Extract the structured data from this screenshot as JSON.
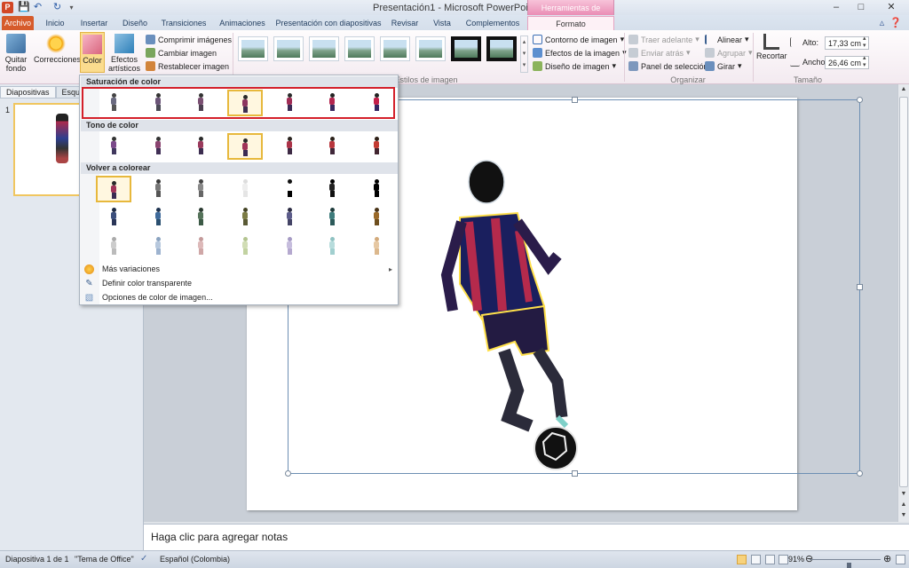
{
  "window": {
    "title": "Presentación1 - Microsoft PowerPoint",
    "context_tools": "Herramientas de imagen"
  },
  "tabs": [
    "Archivo",
    "Inicio",
    "Insertar",
    "Diseño",
    "Transiciones",
    "Animaciones",
    "Presentación con diapositivas",
    "Revisar",
    "Vista",
    "Complementos",
    "Formato"
  ],
  "ribbon": {
    "remove_bg": "Quitar fondo",
    "corrections": "Correcciones",
    "color": "Color",
    "artistic": "Efectos artísticos",
    "compress": "Comprimir imágenes",
    "change": "Cambiar imagen",
    "reset": "Restablecer imagen",
    "styles_label": "Estilos de imagen",
    "border": "Contorno de imagen",
    "effects": "Efectos de la imagen",
    "layout": "Diseño de imagen",
    "bring_forward": "Traer adelante",
    "send_back": "Enviar atrás",
    "selection_pane": "Panel de selección",
    "align": "Alinear",
    "group": "Agrupar",
    "rotate": "Girar",
    "arrange_label": "Organizar",
    "crop": "Recortar",
    "height_label": "Alto:",
    "height_value": "17,33 cm",
    "width_label": "Ancho:",
    "width_value": "26,46 cm",
    "size_label": "Tamaño"
  },
  "left_panel": {
    "tab_slides": "Diapositivas",
    "tab_outline": "Esquema",
    "slide_number": "1"
  },
  "dropdown": {
    "sat_header": "Saturación de color",
    "tone_header": "Tono de color",
    "recolor_header": "Volver a colorear",
    "more_variations": "Más variaciones",
    "set_transparent": "Definir color transparente",
    "picture_color_options": "Opciones de color de imagen..."
  },
  "notes": {
    "placeholder": "Haga clic para agregar notas"
  },
  "status": {
    "slide_info": "Diapositiva 1 de 1",
    "theme": "\"Tema de Office\"",
    "language": "Español (Colombia)",
    "zoom": "91%",
    "zoom_level": 0.55
  },
  "colors": {
    "file_tab": "#d65b2b",
    "context_tab": "#ea8db5",
    "selection_highlight": "#d4202a",
    "selected_swatch": "#e7b83c"
  }
}
